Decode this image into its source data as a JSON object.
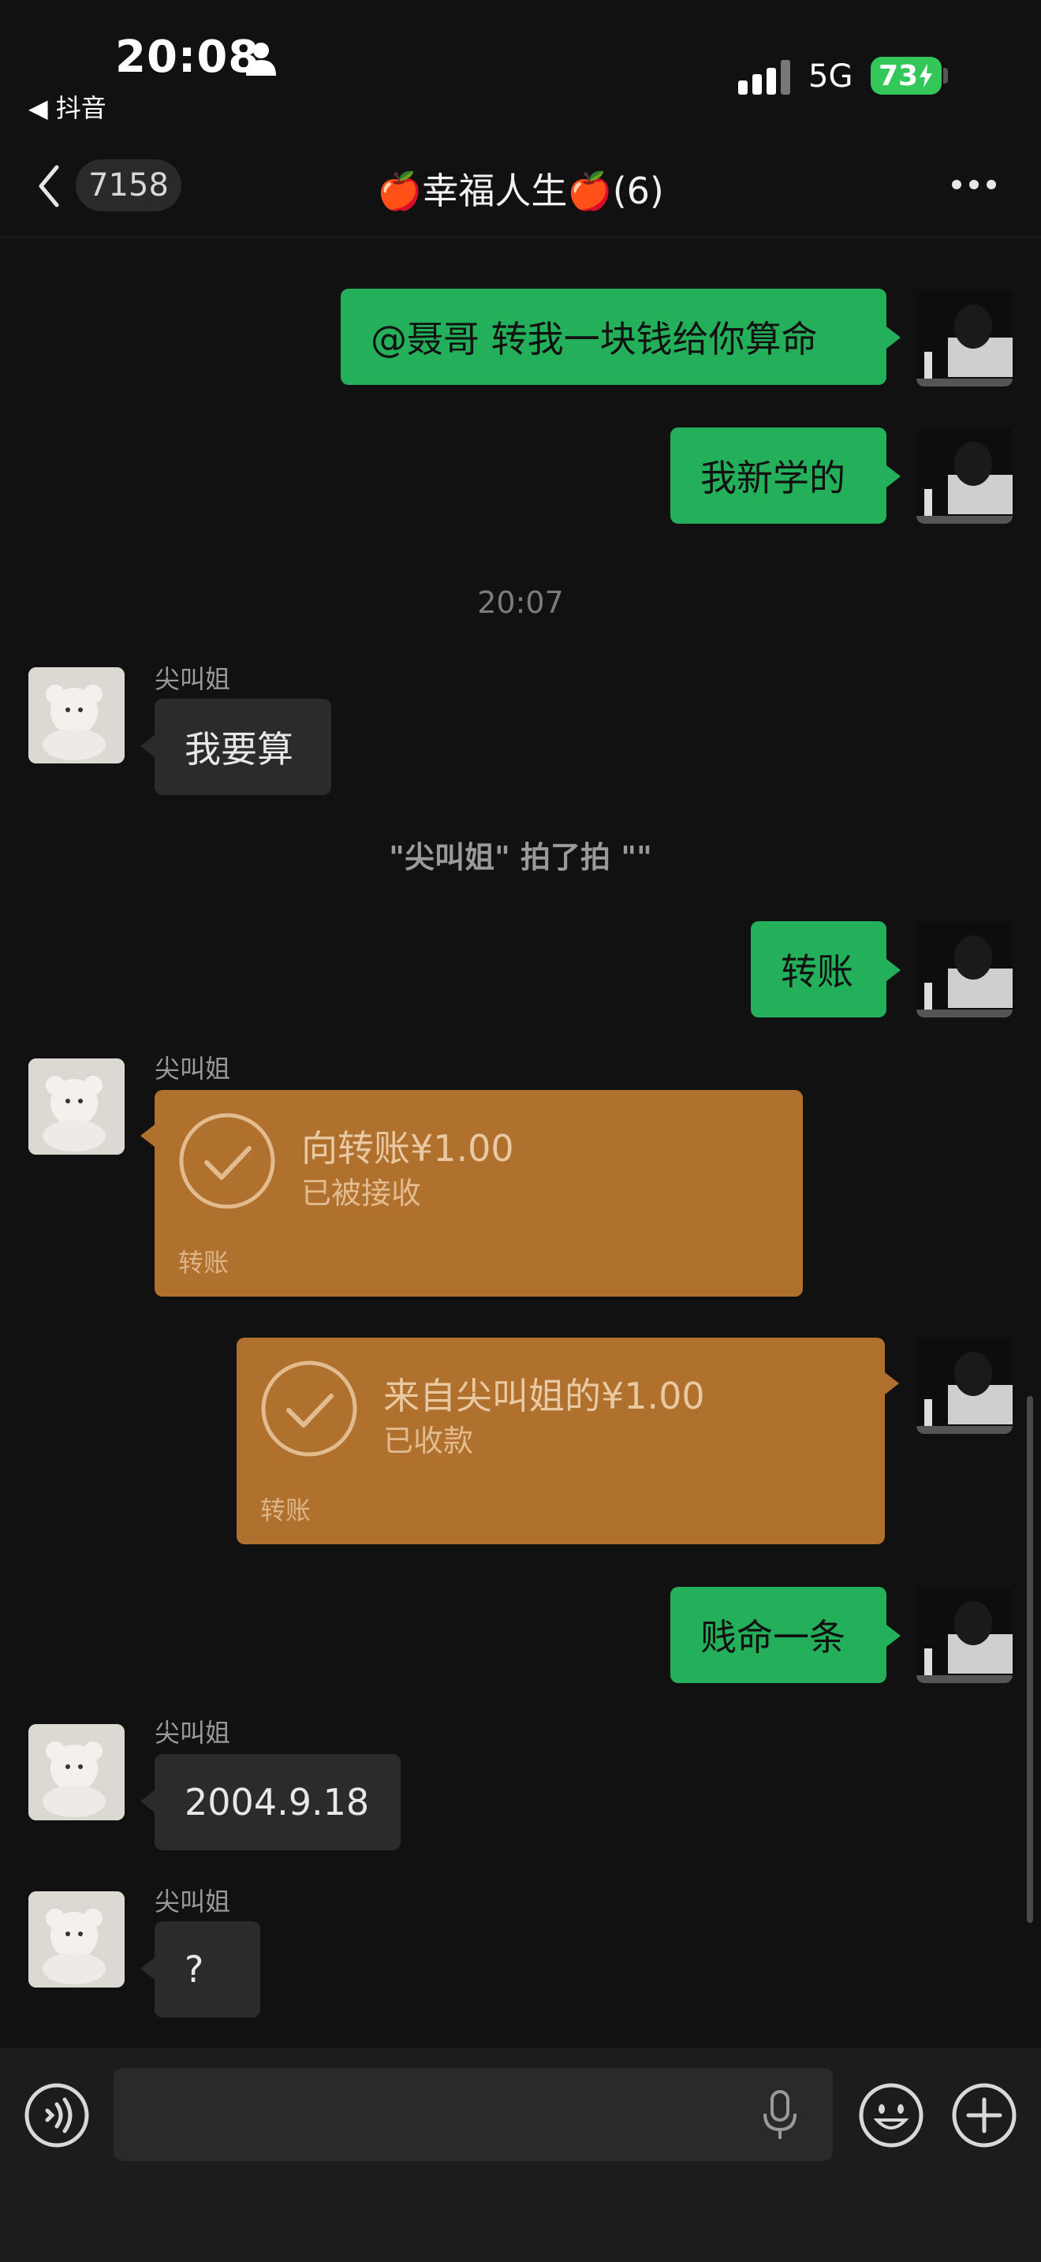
{
  "status_bar": {
    "time": "20:08",
    "back_app": "◀ 抖音",
    "network": "5G",
    "battery": "73"
  },
  "header": {
    "unread_count": "7158",
    "title": "🍎幸福人生🍎(6)"
  },
  "messages": [
    {
      "side": "right",
      "text": "@聂哥 转我一块钱给你算命"
    },
    {
      "side": "right",
      "text": "我新学的"
    },
    {
      "type": "timestamp",
      "text": "20:07"
    },
    {
      "side": "left",
      "sender": "尖叫姐",
      "text": "我要算"
    },
    {
      "type": "system",
      "text": "\"尖叫姐\" 拍了拍 \"\""
    },
    {
      "side": "right",
      "text": "转账"
    },
    {
      "side": "left",
      "sender": "尖叫姐",
      "type": "transfer",
      "amount": "向转账¥1.00",
      "status": "已被接收",
      "footer": "转账"
    },
    {
      "side": "right",
      "type": "transfer",
      "amount": "来自尖叫姐的¥1.00",
      "status": "已收款",
      "footer": "转账"
    },
    {
      "side": "right",
      "text": "贱命一条"
    },
    {
      "side": "left",
      "sender": "尖叫姐",
      "text": "2004.9.18"
    },
    {
      "side": "left",
      "sender": "尖叫姐",
      "text": "?"
    }
  ],
  "colors": {
    "background": "#111111",
    "bubble_self": "#24b05a",
    "bubble_other": "#2b2b2b",
    "transfer_card": "#b0702e",
    "battery": "#33c759"
  },
  "icons": {
    "back": "chevron-left-icon",
    "more": "more-dots-icon",
    "voice": "voice-icon",
    "mic": "microphone-icon",
    "emoji": "emoji-icon",
    "plus": "plus-icon",
    "transfer": "check-circle-icon"
  }
}
